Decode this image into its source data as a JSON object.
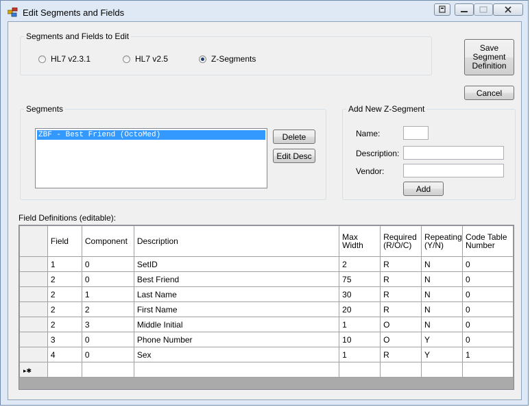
{
  "window": {
    "title": "Edit Segments and Fields"
  },
  "segments_to_edit": {
    "label": "Segments and Fields to Edit",
    "options": [
      {
        "label": "HL7 v2.3.1",
        "checked": false
      },
      {
        "label": "HL7 v2.5",
        "checked": false
      },
      {
        "label": "Z-Segments",
        "checked": true
      }
    ]
  },
  "buttons": {
    "save": "Save Segment Definition",
    "cancel": "Cancel",
    "delete": "Delete",
    "edit_desc": "Edit Desc",
    "add": "Add"
  },
  "segments": {
    "label": "Segments",
    "items": [
      "ZBF - Best Friend (OctoMed)"
    ],
    "selected_index": 0
  },
  "add_z_segment": {
    "label": "Add New Z-Segment",
    "name_label": "Name:",
    "name_value": "",
    "description_label": "Description:",
    "description_value": "",
    "vendor_label": "Vendor:",
    "vendor_value": ""
  },
  "field_definitions": {
    "label": "Field Definitions (editable):",
    "columns": [
      "Field",
      "Component",
      "Description",
      "Max Width",
      "Required (R/O/C)",
      "Repeating (Y/N)",
      "Code Table Number"
    ],
    "rows": [
      [
        "1",
        "0",
        "SetID",
        "2",
        "R",
        "N",
        "0"
      ],
      [
        "2",
        "0",
        "Best Friend",
        "75",
        "R",
        "N",
        "0"
      ],
      [
        "2",
        "1",
        "Last Name",
        "30",
        "R",
        "N",
        "0"
      ],
      [
        "2",
        "2",
        "First Name",
        "20",
        "R",
        "N",
        "0"
      ],
      [
        "2",
        "3",
        "Middle Initial",
        "1",
        "O",
        "N",
        "0"
      ],
      [
        "3",
        "0",
        "Phone Number",
        "10",
        "O",
        "Y",
        "0"
      ],
      [
        "4",
        "0",
        "Sex",
        "1",
        "R",
        "Y",
        "1"
      ]
    ]
  }
}
